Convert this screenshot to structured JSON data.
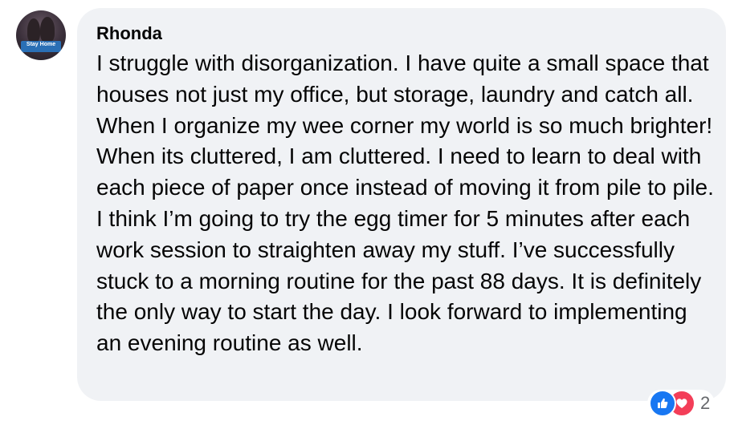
{
  "comment": {
    "author": "Rhonda",
    "avatar_badge": "Stay Home",
    "text": "I struggle with disorganization. I have quite a small space that houses not just my office, but storage, laundry and catch all. When I organize my wee corner my world is so much brighter! When its cluttered, I am cluttered. I need to learn to deal with each piece of paper once instead of moving it from pile to pile. I think I’m going to try the egg timer for 5 minutes after each work session to straighten away my stuff. I’ve successfully stuck to a morning routine for the past 88 days. It is definitely the only way to start the day. I look forward to implementing an evening routine as well."
  },
  "reactions": {
    "icons": [
      "like-icon",
      "love-icon"
    ],
    "count": "2"
  },
  "colors": {
    "bubble_bg": "#f0f2f5",
    "like_blue": "#1877f2",
    "love_red": "#f33e58",
    "count_gray": "#65676b"
  }
}
